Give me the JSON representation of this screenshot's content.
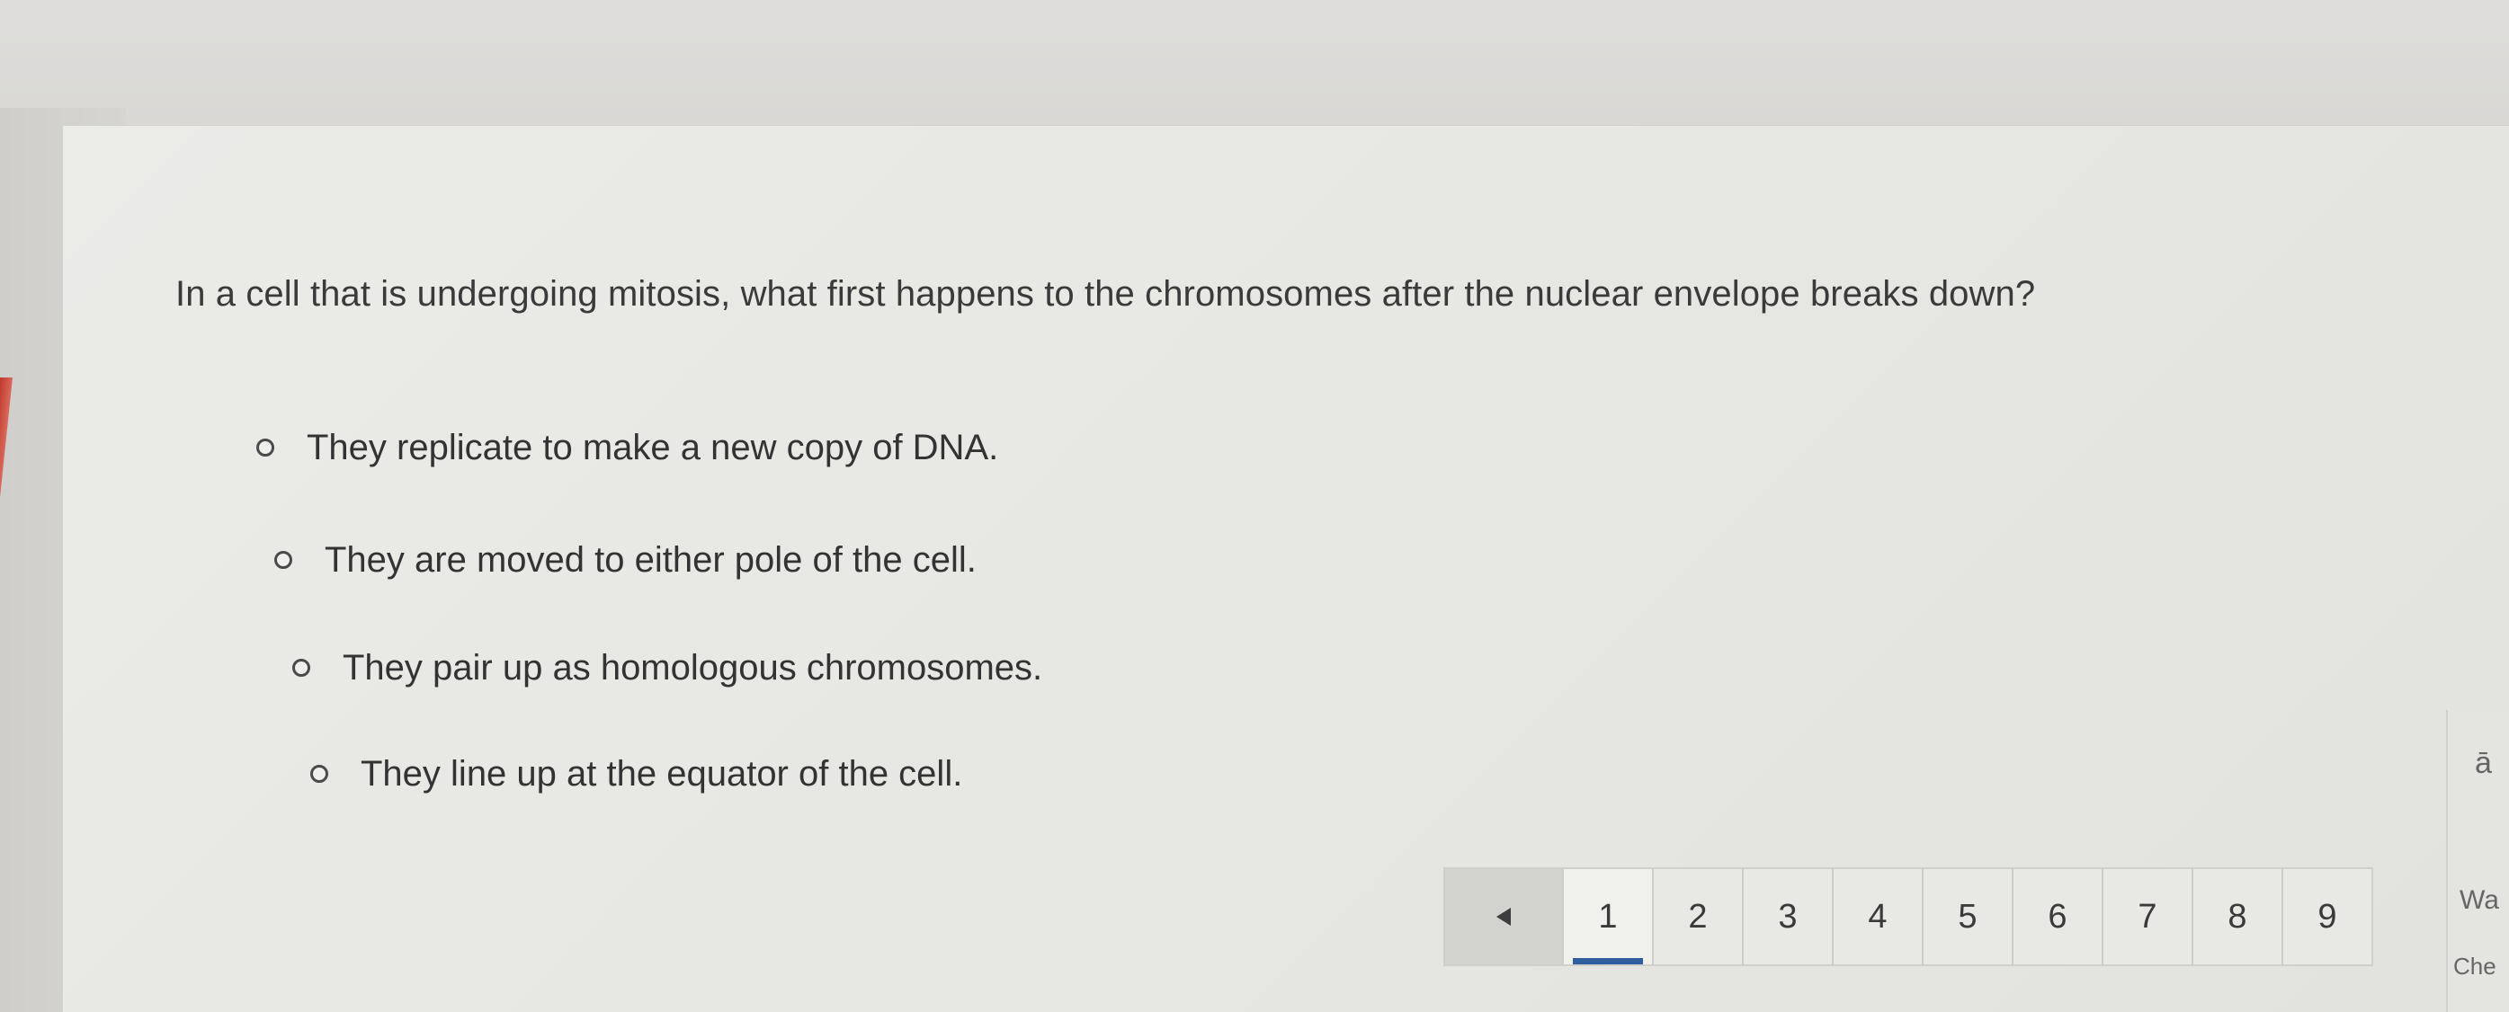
{
  "question": {
    "text": "In a cell that is undergoing mitosis, what first happens to the chromosomes after the nuclear envelope breaks down?"
  },
  "choices": [
    {
      "label": "They replicate to make a new copy of DNA."
    },
    {
      "label": "They are moved to either pole of the cell."
    },
    {
      "label": "They pair up as homologous chromosomes."
    },
    {
      "label": "They line up at the equator of the cell."
    }
  ],
  "pagination": {
    "prev_icon": "triangle-left-icon",
    "current_page": "1",
    "pages": [
      "1",
      "2",
      "3",
      "4",
      "5",
      "6",
      "7",
      "8",
      "9"
    ]
  },
  "right_panel": {
    "icon_char": "ā",
    "partial_text_1": "Wa",
    "partial_text_2": "Che"
  },
  "colors": {
    "accent": "#2f5d9e",
    "panel": "#e8e8e5",
    "edge_red": "#c0392b"
  }
}
